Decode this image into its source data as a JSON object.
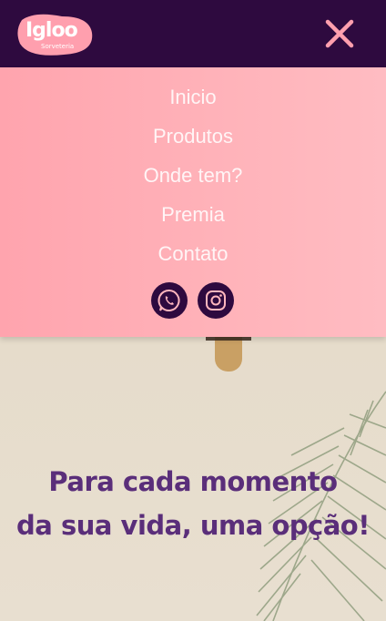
{
  "brand": {
    "name": "Igloo",
    "tagline": "Sorveteria"
  },
  "header": {
    "close_icon": "close-icon"
  },
  "menu": {
    "items": [
      {
        "label": "Inicio"
      },
      {
        "label": "Produtos"
      },
      {
        "label": "Onde tem?"
      },
      {
        "label": "Premia"
      },
      {
        "label": "Contato"
      }
    ],
    "social": [
      {
        "icon": "whatsapp-icon"
      },
      {
        "icon": "instagram-icon"
      }
    ]
  },
  "hero": {
    "headline_line1": "Para cada momento",
    "headline_line2": "da sua vida, uma opção!"
  },
  "colors": {
    "header_bg": "#2e0a3f",
    "menu_bg": "#ffb2b9",
    "accent": "#ff9fae",
    "headline": "#5a2e7a"
  }
}
